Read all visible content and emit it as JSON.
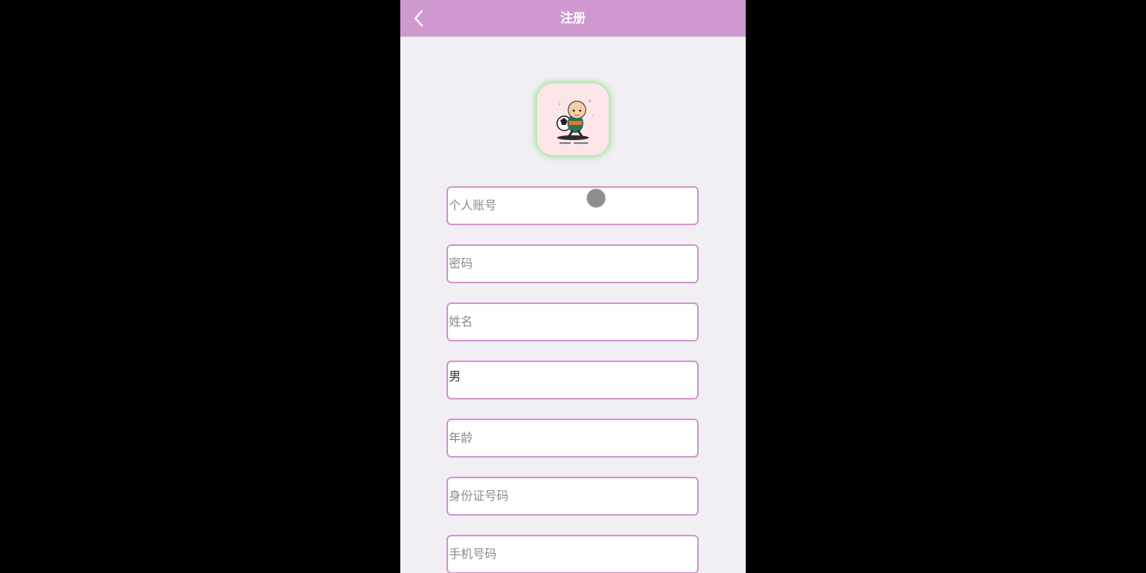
{
  "header": {
    "title": "注册",
    "back_icon": "chevron-left-icon",
    "background": "#cf99d0"
  },
  "logo": {
    "icon": "app-logo-icon"
  },
  "form": {
    "account_placeholder": "个人账号",
    "password_placeholder": "密码",
    "name_placeholder": "姓名",
    "gender_value": "男",
    "age_placeholder": "年龄",
    "id_number_placeholder": "身份证号码",
    "phone_placeholder": "手机号码"
  },
  "colors": {
    "accent": "#cf99d0",
    "background": "#f1eff3",
    "placeholder": "#8a8a8a",
    "input_text": "#333333"
  }
}
